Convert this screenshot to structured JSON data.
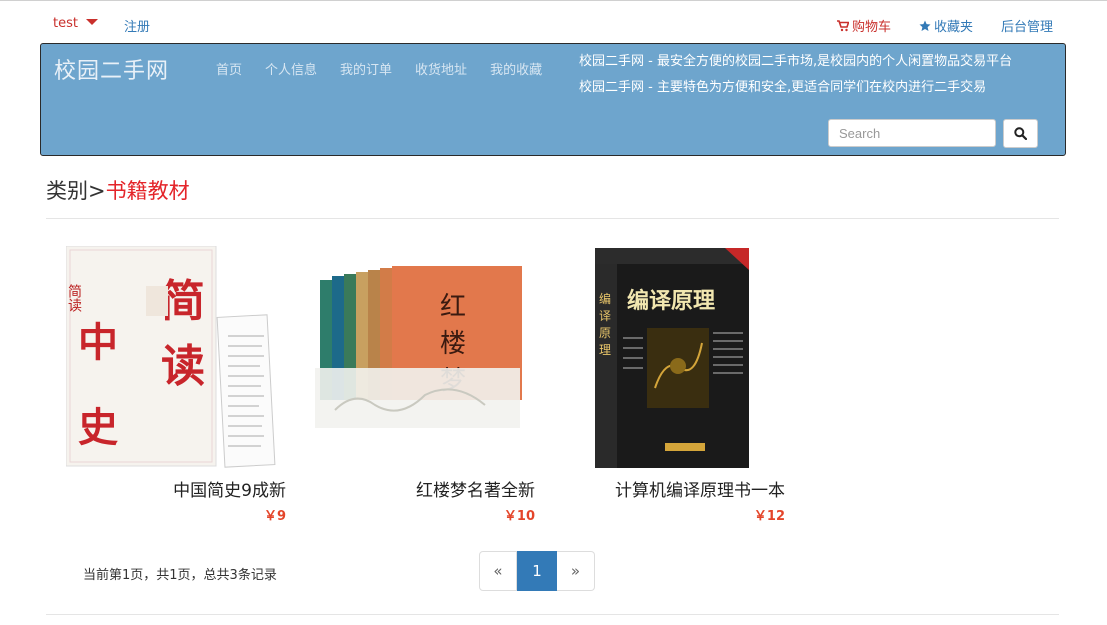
{
  "topbar": {
    "user": "test",
    "register": "注册",
    "cart": "购物车",
    "favorites": "收藏夹",
    "admin": "后台管理"
  },
  "header": {
    "brand": "校园二手网",
    "nav": [
      "首页",
      "个人信息",
      "我的订单",
      "收货地址",
      "我的收藏"
    ],
    "slogan1": "校园二手网 - 最安全方便的校园二手市场,是校园内的个人闲置物品交易平台",
    "slogan2": "校园二手网 - 主要特色为方便和安全,更适合同学们在校内进行二手交易",
    "search_placeholder": "Search"
  },
  "category": {
    "prefix": "类别>",
    "current": "书籍教材"
  },
  "products": [
    {
      "name": "中国简史9成新",
      "price": "￥9"
    },
    {
      "name": "红楼梦名著全新",
      "price": "￥10"
    },
    {
      "name": "计算机编译原理书一本",
      "price": "￥12"
    }
  ],
  "pagination": {
    "info": "当前第1页，共1页，总共3条记录",
    "prev": "«",
    "current": "1",
    "next": "»"
  },
  "colors": {
    "header_bg": "#6ea5cd",
    "accent_red": "#e4252a",
    "link_blue": "#337ab7"
  }
}
